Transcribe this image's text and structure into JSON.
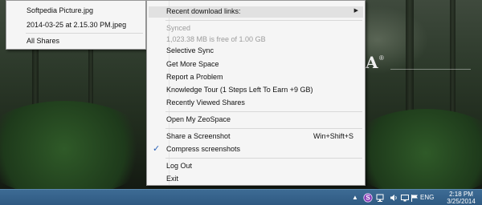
{
  "recent_files_menu": {
    "items": [
      "Softpedia Picture.jpg",
      "2014-03-25 at 2.15.30 PM.jpeg"
    ],
    "all_shares": "All Shares"
  },
  "context_menu": {
    "recent_download_links": "Recent download links:",
    "synced": "Synced",
    "storage": "1,023.38 MB is free of 1.00 GB",
    "selective_sync": "Selective Sync",
    "get_more_space": "Get More Space",
    "report_problem": "Report a Problem",
    "knowledge_tour": "Knowledge Tour (1 Steps Left To Earn +9 GB)",
    "recently_viewed": "Recently Viewed Shares",
    "open_zeospace": "Open My ZeoSpace",
    "share_screenshot": "Share a Screenshot",
    "share_shortcut": "Win+Shift+S",
    "compress_screenshots": "Compress screenshots",
    "compress_checked": true,
    "log_out": "Log Out",
    "exit": "Exit"
  },
  "desktop": {
    "logo": "A"
  },
  "taskbar": {
    "language": "ENG",
    "time": "2:18 PM",
    "date": "3/25/2014"
  },
  "colors": {
    "menu_bg": "#f5f5f5",
    "highlight": "#e1e1e1",
    "taskbar": "#2f5a82",
    "check": "#2a62b8"
  }
}
